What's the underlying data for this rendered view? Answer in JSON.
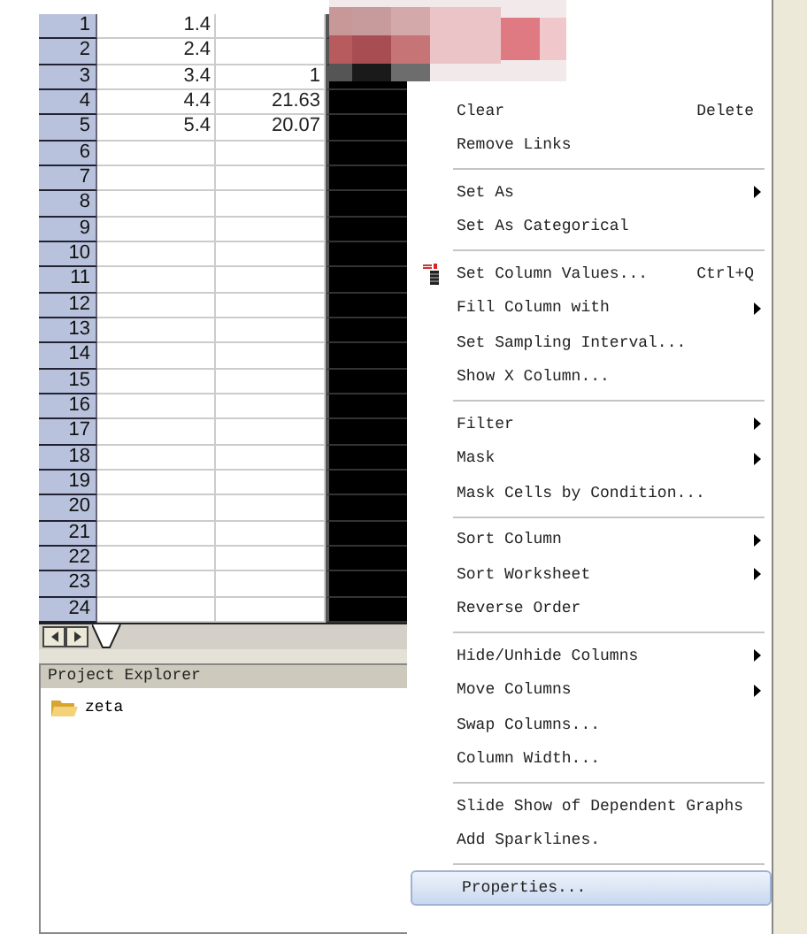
{
  "worksheet": {
    "columns": [
      {
        "selected": false
      },
      {
        "selected": false
      },
      {
        "selected": true
      }
    ],
    "rows": [
      {
        "label": "1",
        "column_1": "1.4"
      },
      {
        "label": "2",
        "column_1": "2.4"
      },
      {
        "label": "3",
        "column_1": "3.4",
        "column_2": "1"
      },
      {
        "label": "4",
        "column_1": "4.4",
        "column_2": "21.63"
      },
      {
        "label": "5",
        "column_1": "5.4",
        "column_2": "20.07"
      },
      {
        "label": "6"
      },
      {
        "label": "7"
      },
      {
        "label": "8"
      },
      {
        "label": "9"
      },
      {
        "label": "10"
      },
      {
        "label": "11"
      },
      {
        "label": "12"
      },
      {
        "label": "13"
      },
      {
        "label": "14"
      },
      {
        "label": "15"
      },
      {
        "label": "16"
      },
      {
        "label": "17"
      },
      {
        "label": "18"
      },
      {
        "label": "19"
      },
      {
        "label": "20"
      },
      {
        "label": "21"
      },
      {
        "label": "22"
      },
      {
        "label": "23"
      },
      {
        "label": "24"
      }
    ]
  },
  "project_explorer": {
    "title": "Project Explorer",
    "items": [
      {
        "label": "zeta",
        "selected": false
      }
    ]
  },
  "context_menu": [
    {
      "kind": "item",
      "label": "Clear",
      "shortcut": "Delete",
      "submenu": false,
      "selected": false
    },
    {
      "kind": "item",
      "label": "Remove Links",
      "submenu": false,
      "selected": false
    },
    {
      "kind": "separator"
    },
    {
      "kind": "item",
      "label": "Set As",
      "submenu": true,
      "selected": false
    },
    {
      "kind": "item",
      "label": "Set As Categorical",
      "submenu": false,
      "selected": false
    },
    {
      "kind": "separator"
    },
    {
      "kind": "icon_item",
      "label": "Set Column Values...",
      "shortcut": "Ctrl+Q",
      "submenu": false,
      "selected": false
    },
    {
      "kind": "item",
      "label": "Fill Column with",
      "submenu": true,
      "selected": false
    },
    {
      "kind": "item",
      "label": "Set Sampling Interval...",
      "submenu": false,
      "selected": false
    },
    {
      "kind": "item",
      "label": "Show X Column...",
      "submenu": false,
      "selected": false
    },
    {
      "kind": "separator"
    },
    {
      "kind": "item",
      "label": "Filter",
      "submenu": true,
      "selected": false
    },
    {
      "kind": "item",
      "label": "Mask",
      "submenu": true,
      "selected": false
    },
    {
      "kind": "item",
      "label": "Mask Cells by Condition...",
      "submenu": false,
      "selected": false
    },
    {
      "kind": "separator"
    },
    {
      "kind": "item",
      "label": "Sort Column",
      "submenu": true,
      "selected": false
    },
    {
      "kind": "item",
      "label": "Sort Worksheet",
      "submenu": true,
      "selected": false
    },
    {
      "kind": "item",
      "label": "Reverse Order",
      "submenu": false,
      "selected": false
    },
    {
      "kind": "separator"
    },
    {
      "kind": "item",
      "label": "Hide/Unhide Columns",
      "submenu": true,
      "selected": false
    },
    {
      "kind": "item",
      "label": "Move Columns",
      "submenu": true,
      "selected": false
    },
    {
      "kind": "item",
      "label": "Swap Columns...",
      "submenu": false,
      "selected": false
    },
    {
      "kind": "item",
      "label": "Column Width...",
      "submenu": false,
      "selected": false
    },
    {
      "kind": "separator"
    },
    {
      "kind": "item",
      "label": "Slide Show of Dependent Graphs",
      "submenu": false,
      "selected": false
    },
    {
      "kind": "item",
      "label": "Add Sparklines.",
      "submenu": false,
      "selected": false
    },
    {
      "kind": "separator"
    },
    {
      "kind": "item",
      "label": "Properties...",
      "submenu": false,
      "selected": true
    }
  ]
}
